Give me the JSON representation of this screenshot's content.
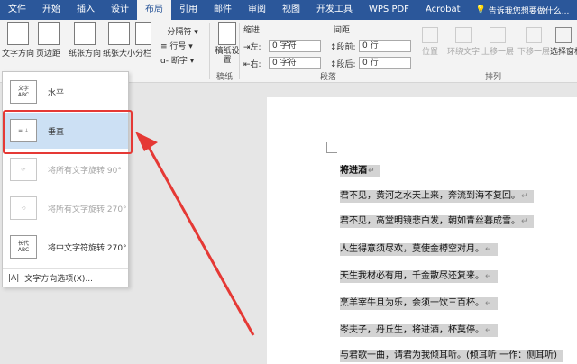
{
  "tabs": [
    "文件",
    "开始",
    "插入",
    "设计",
    "布局",
    "引用",
    "邮件",
    "审阅",
    "视图",
    "开发工具",
    "WPS PDF",
    "Acrobat"
  ],
  "active_tab": "布局",
  "tell_me": "告诉我您想要做什么...",
  "ribbon": {
    "text_direction": "文字方向",
    "margins": "页边距",
    "orientation": "纸张方向",
    "size": "纸张大小",
    "columns": "分栏",
    "breaks": "分隔符",
    "line_numbers": "行号",
    "hyphenation": "断字",
    "draft_paper": "稿纸设置",
    "draft_group": "稿纸",
    "indent": "缩进",
    "spacing": "间距",
    "left": "左:",
    "right": "右:",
    "before": "段前:",
    "after": "段后:",
    "left_val": "0 字符",
    "right_val": "0 字符",
    "before_val": "0 行",
    "after_val": "0 行",
    "paragraph_group": "段落",
    "position": "位置",
    "wrap_text": "环绕文字",
    "bring_forward": "上移一层",
    "send_backward": "下移一层",
    "selection_pane": "选择窗格",
    "arrange_group": "排列"
  },
  "dropdown": {
    "items": [
      {
        "label": "水平",
        "icon": "文字\nABC"
      },
      {
        "label": "垂直",
        "icon": "≡⇣"
      },
      {
        "label": "将所有文字旋转 90°",
        "icon": "⟳"
      },
      {
        "label": "将所有文字旋转 270°",
        "icon": "⟲"
      },
      {
        "label": "将中文字符旋转 270°",
        "icon": "长代\nABC"
      }
    ],
    "options": "文字方向选项(X)..."
  },
  "document": {
    "lines": [
      "将进酒",
      "君不见，黄河之水天上来，奔流到海不复回。",
      "君不见，高堂明镜悲白发，朝如青丝暮成雪。",
      "人生得意须尽欢，莫使金樽空对月。",
      "天生我材必有用，千金散尽还复来。",
      "烹羊宰牛且为乐，会须一饮三百杯。",
      "岑夫子，丹丘生，将进酒，杯莫停。",
      "与君歌一曲，请君为我倾耳听。(倾耳听 一作：侧耳听)"
    ]
  }
}
